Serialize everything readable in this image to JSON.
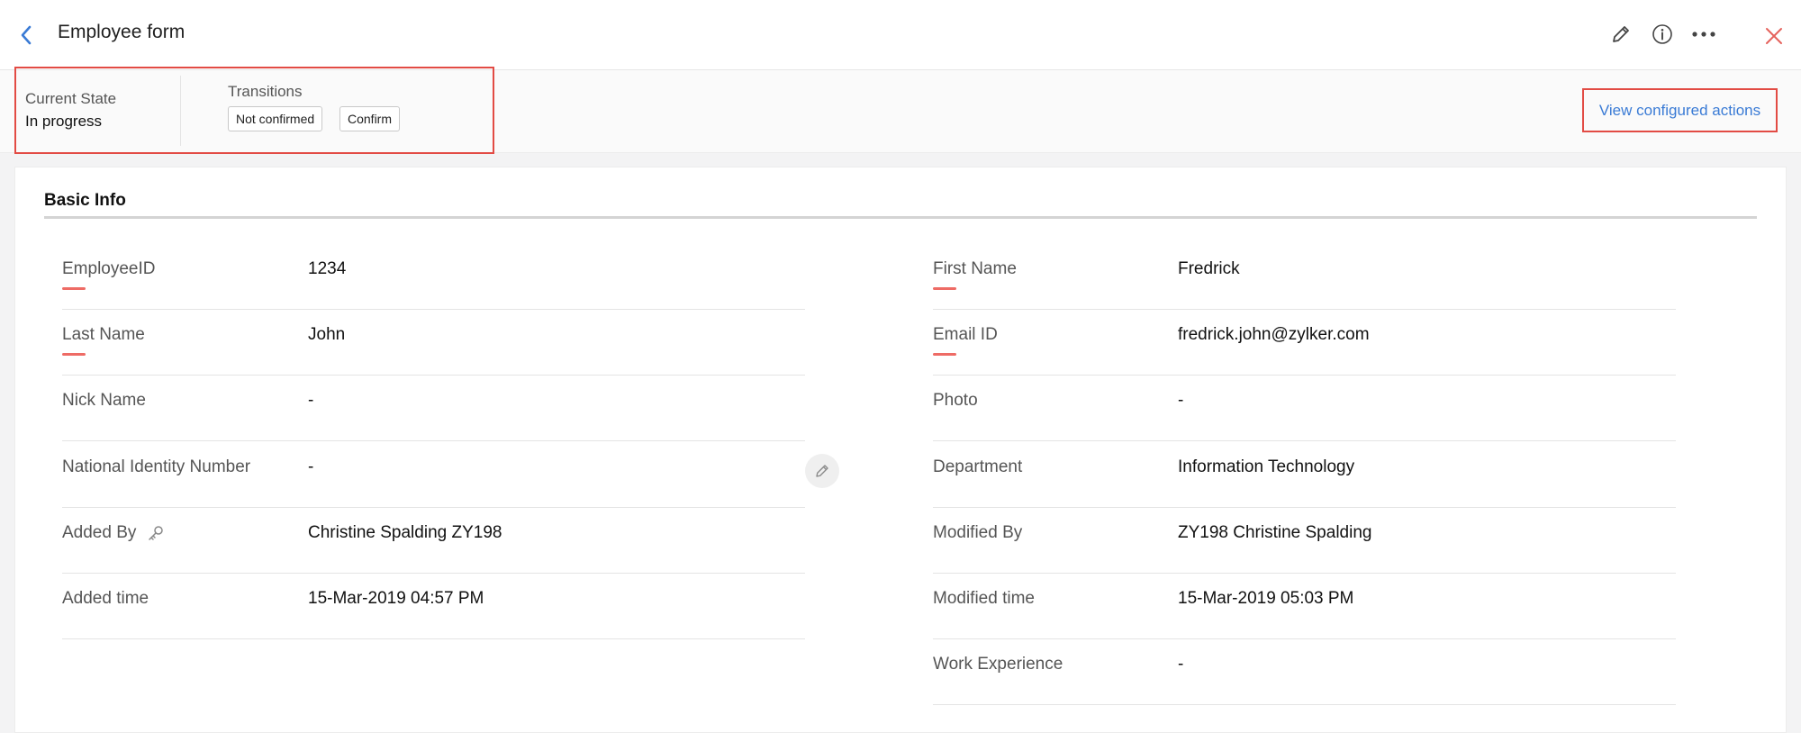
{
  "header": {
    "title": "Employee form"
  },
  "state": {
    "current_state_label": "Current State",
    "current_state_value": "In progress",
    "transitions_label": "Transitions",
    "transitions": [
      "Not confirmed",
      "Confirm"
    ],
    "view_actions_label": "View configured actions"
  },
  "section": {
    "title": "Basic Info"
  },
  "left_fields": [
    {
      "label": "EmployeeID",
      "value": "1234",
      "required": true
    },
    {
      "label": "Last Name",
      "value": "John",
      "required": true
    },
    {
      "label": "Nick Name",
      "value": "-",
      "required": false
    },
    {
      "label": "National Identity Number",
      "value": "-",
      "required": false
    },
    {
      "label": "Added By",
      "value": "Christine Spalding ZY198",
      "required": false
    },
    {
      "label": "Added time",
      "value": "15-Mar-2019 04:57 PM",
      "required": false
    }
  ],
  "right_fields": [
    {
      "label": "First Name",
      "value": "Fredrick",
      "required": true
    },
    {
      "label": "Email ID",
      "value": "fredrick.john@zylker.com",
      "required": true
    },
    {
      "label": "Photo",
      "value": "-",
      "required": false
    },
    {
      "label": "Department",
      "value": "Information Technology",
      "required": false
    },
    {
      "label": "Modified By",
      "value": "ZY198 Christine Spalding",
      "required": false
    },
    {
      "label": "Modified time",
      "value": "15-Mar-2019 05:03 PM",
      "required": false
    },
    {
      "label": "Work Experience",
      "value": "-",
      "required": false
    }
  ],
  "colors": {
    "accent_blue": "#3a7bd5",
    "highlight_red": "#e24b44",
    "required_marker": "#ee6b65"
  }
}
